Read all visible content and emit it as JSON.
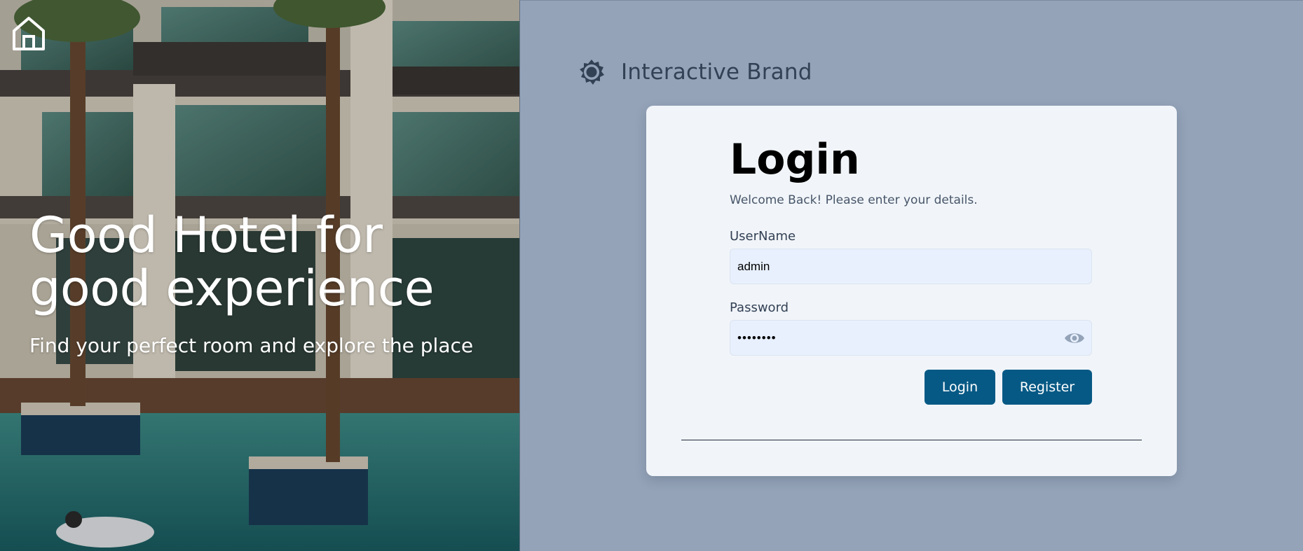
{
  "hero": {
    "title_line1": "Good Hotel for",
    "title_line2": "good experience",
    "subtitle": "Find your perfect room and explore the place",
    "home_icon": "home-icon"
  },
  "brand": {
    "name": "Interactive Brand",
    "icon": "gear-icon"
  },
  "login": {
    "title": "Login",
    "subtitle": "Welcome Back! Please enter your details.",
    "username_label": "UserName",
    "username_value": "admin",
    "password_label": "Password",
    "password_value": "admin123",
    "toggle_icon": "eye-icon",
    "login_label": "Login",
    "register_label": "Register"
  },
  "colors": {
    "panel_bg": "#94a3b8",
    "card_bg": "#f1f5f9",
    "accent": "#075985",
    "input_bg": "#e8f0fe",
    "brand_text": "#334155"
  }
}
